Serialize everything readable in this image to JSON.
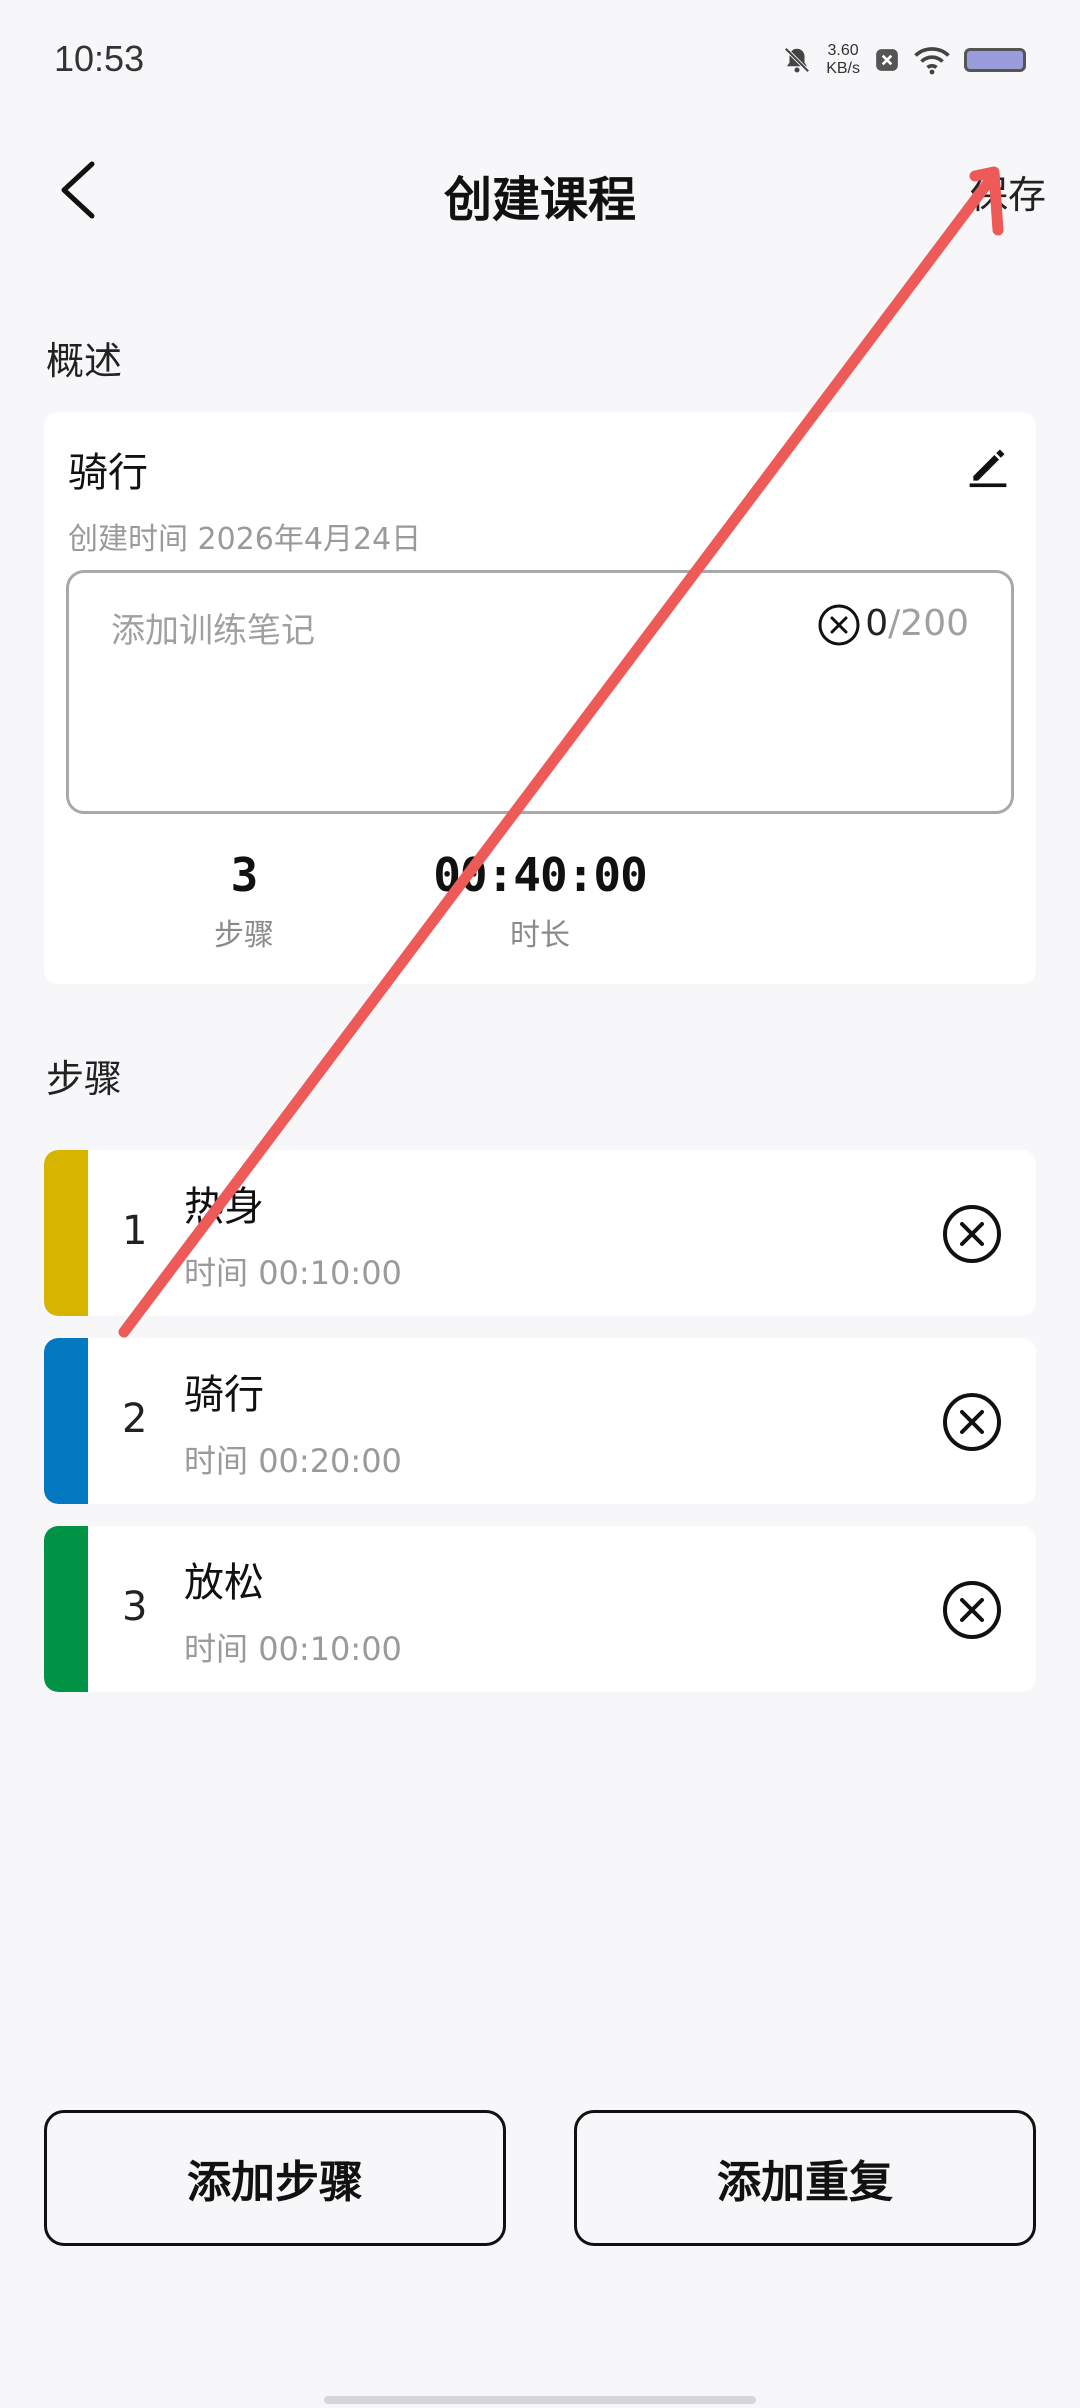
{
  "status_bar": {
    "time": "10:53",
    "net_speed_value": "3.60",
    "net_speed_unit": "KB/s",
    "icons": [
      "bell-off-icon",
      "close-box-icon",
      "wifi-icon",
      "battery-icon"
    ]
  },
  "header": {
    "back_icon": "chevron-left-icon",
    "title": "创建课程",
    "save_label": "保存"
  },
  "overview": {
    "section_label": "概述",
    "course_name": "骑行",
    "edit_icon": "pencil-icon",
    "created_label": "创建时间",
    "created_date": "2026年4月24日",
    "notes": {
      "value": "",
      "placeholder": "添加训练笔记",
      "count_current": "0",
      "count_max": "/200"
    },
    "stats": {
      "steps_value": "3",
      "steps_label": "步骤",
      "duration_value": "00:40:00",
      "duration_label": "时长"
    }
  },
  "steps": {
    "section_label": "步骤",
    "time_label": "时间",
    "items": [
      {
        "index": "1",
        "name": "热身",
        "time": "00:10:00",
        "color": "#d6b400"
      },
      {
        "index": "2",
        "name": "骑行",
        "time": "00:20:00",
        "color": "#0278c0"
      },
      {
        "index": "3",
        "name": "放松",
        "time": "00:10:00",
        "color": "#009245"
      }
    ]
  },
  "actions": {
    "add_step_label": "添加步骤",
    "add_repeat_label": "添加重复"
  },
  "overlay": {
    "arrow_color": "#ee5a58"
  }
}
